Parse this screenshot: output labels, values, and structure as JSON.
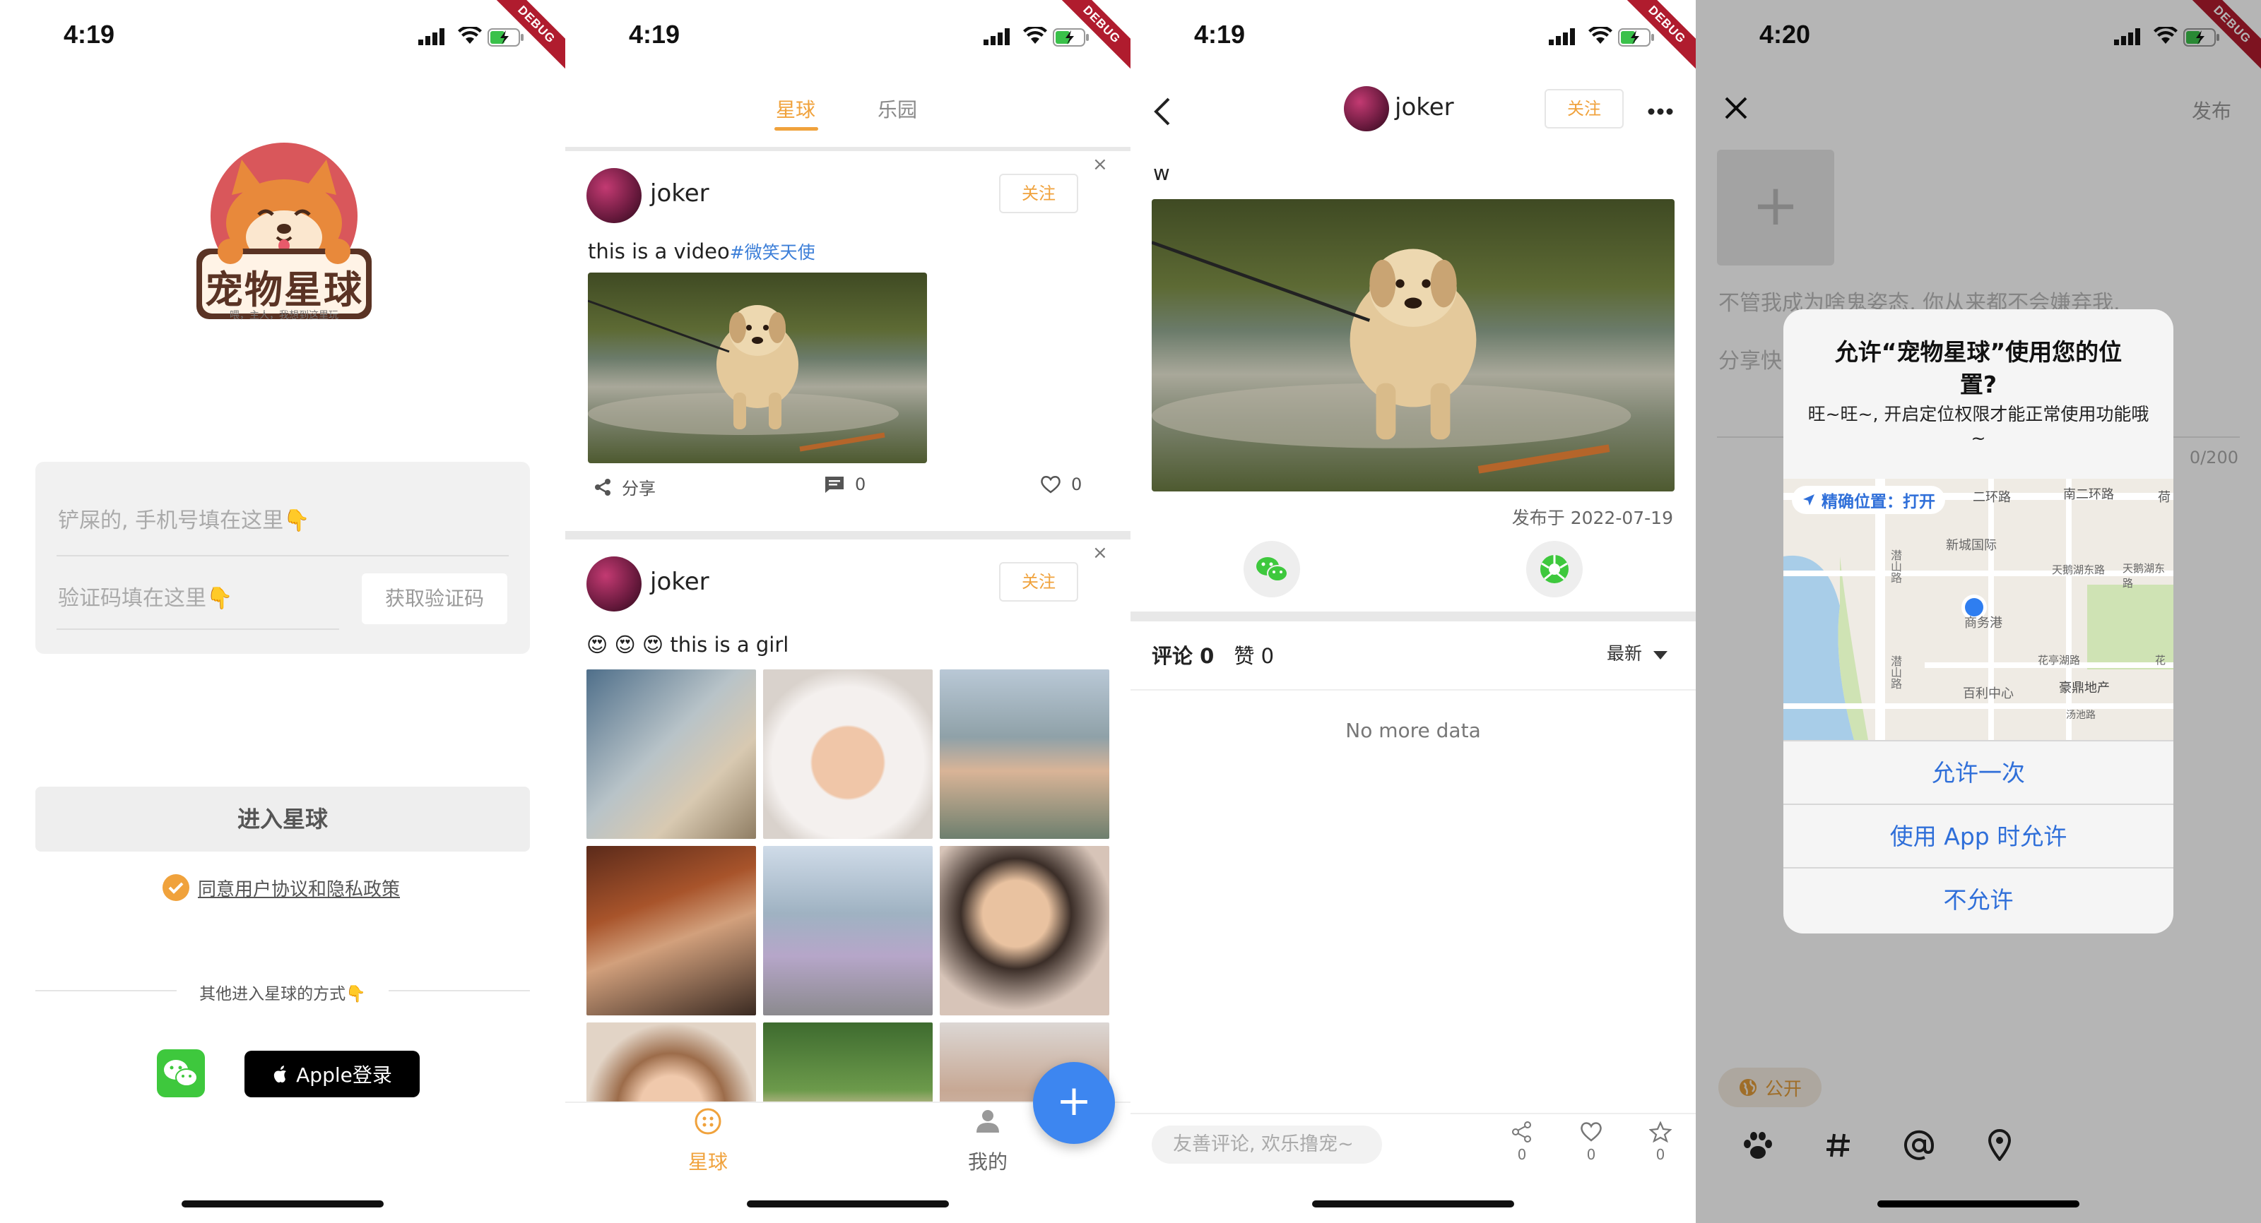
{
  "status": {
    "s1_time": "4:19",
    "s2_time": "4:19",
    "s3_time": "4:19",
    "s4_time": "4:20",
    "debug_label": "DEBUG"
  },
  "login": {
    "logo_title": "宠物星球",
    "logo_slogan": "喂，主人，我想到这里玩",
    "phone_placeholder": "铲屎的, 手机号填在这里👇",
    "code_placeholder": "验证码填在这里👇",
    "get_code_button": "获取验证码",
    "enter_button": "进入星球",
    "agree_text": "同意用户协议和隐私政策",
    "other_methods": "其他进入星球的方式👇",
    "apple_login": "Apple登录"
  },
  "feed": {
    "tabs": [
      "星球",
      "乐园"
    ],
    "posts": [
      {
        "username": "joker",
        "follow": "关注",
        "text": "this is a video",
        "tag": "#微笑天使",
        "share_label": "分享",
        "comments": "0",
        "likes": "0"
      },
      {
        "username": "joker",
        "follow": "关注",
        "text": "😍 😍 😍   this is a girl"
      }
    ],
    "nav": [
      "星球",
      "我的"
    ],
    "fab": "+"
  },
  "detail": {
    "username": "joker",
    "follow": "关注",
    "content": "w",
    "published": "发布于 2022-07-19",
    "comments_label": "评论 0",
    "likes_label": "赞 0",
    "sort_label": "最新",
    "no_more": "No more data",
    "comment_placeholder": "友善评论, 欢乐撸宠~",
    "share_count": "0",
    "like_count": "0",
    "star_count": "0"
  },
  "publish": {
    "publish_button": "发布",
    "placeholder_line1": "不管我成为啥鬼姿态, 你从来都不会嫌弃我.",
    "placeholder_line2": "分享快",
    "char_count": "0/200",
    "visibility": "公开",
    "dialog": {
      "title": "允许“宠物星球”使用您的位置?",
      "message": "旺~旺~, 开启定位权限才能正常使用功能哦~",
      "precise": "精确位置：打开",
      "map_labels": [
        "二环路",
        "南二环路",
        "荷",
        "新城国际",
        "天鹅湖东路",
        "天鹅湖东路",
        "商务港",
        "花亭湖路",
        "百利中心",
        "豪鼎地产",
        "汤池路",
        "潜山路",
        "潜山路",
        "花"
      ],
      "allow_once": "允许一次",
      "allow_while_using": "使用 App 时允许",
      "deny": "不允许"
    }
  }
}
